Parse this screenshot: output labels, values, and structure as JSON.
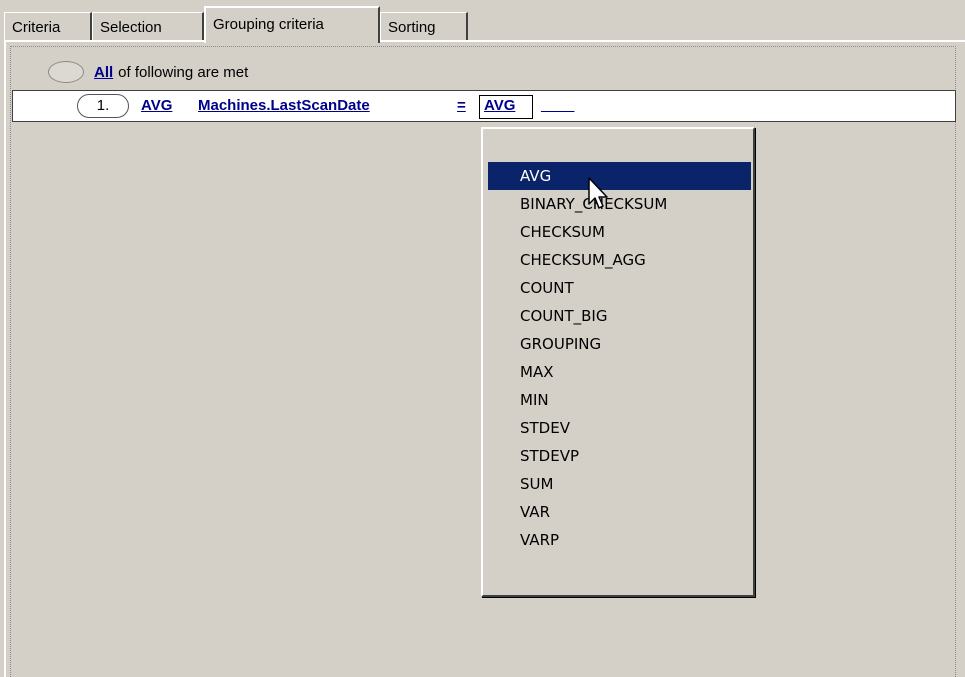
{
  "tabs": [
    {
      "label": "Criteria"
    },
    {
      "label": "Selection"
    },
    {
      "label": "Grouping criteria"
    },
    {
      "label": "Sorting"
    }
  ],
  "active_tab": "Grouping criteria",
  "root_group": {
    "quantifier": "All",
    "suffix": "of following are met"
  },
  "condition": {
    "index": "1.",
    "aggregate": "AVG",
    "field": "Machines.LastScanDate",
    "operator": "=",
    "value_function": "AVG",
    "value_placeholder": "____"
  },
  "dropdown": {
    "selected": "AVG",
    "options": [
      "AVG",
      "BINARY_CHECKSUM",
      "CHECKSUM",
      "CHECKSUM_AGG",
      "COUNT",
      "COUNT_BIG",
      "GROUPING",
      "MAX",
      "MIN",
      "STDEV",
      "STDEVP",
      "SUM",
      "VAR",
      "VARP"
    ]
  },
  "colors": {
    "window_bg": "#d4d0c8",
    "link": "#00008b",
    "selection": "#0a246a"
  },
  "icons": {
    "cursor": "arrow-cursor-icon"
  }
}
